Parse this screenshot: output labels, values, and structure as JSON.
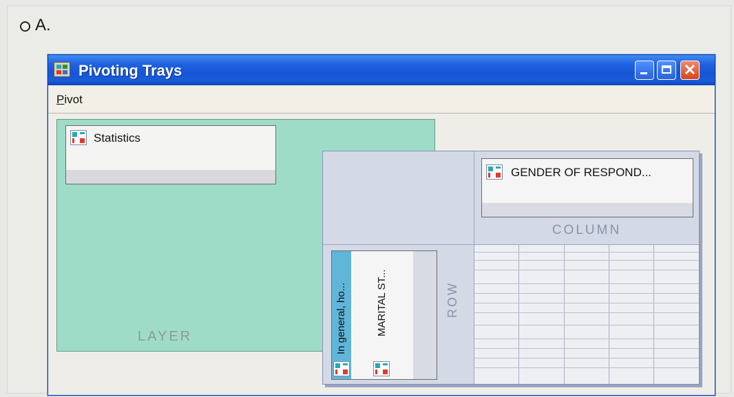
{
  "option": {
    "label": "A."
  },
  "window": {
    "title": "Pivoting Trays",
    "buttons": {
      "minimize": "minimize-icon",
      "maximize": "maximize-icon",
      "close": "close-icon"
    }
  },
  "menu": {
    "items": [
      {
        "label": "Pivot",
        "mnemonic": "P"
      }
    ]
  },
  "trays": {
    "layer": {
      "label": "LAYER",
      "items": [
        "Statistics"
      ]
    },
    "column": {
      "label": "COLUMN",
      "items": [
        "GENDER OF RESPOND..."
      ]
    },
    "row": {
      "label": "ROW",
      "items": [
        "In general, ho...",
        "MARITAL ST..."
      ]
    }
  },
  "colors": {
    "titlebar": "#1556d6",
    "layer_tray": "#9fdcc8",
    "row_selected": "#5fb6d9",
    "icon_teal": "#2aa7b7",
    "icon_red": "#e03a2f"
  }
}
